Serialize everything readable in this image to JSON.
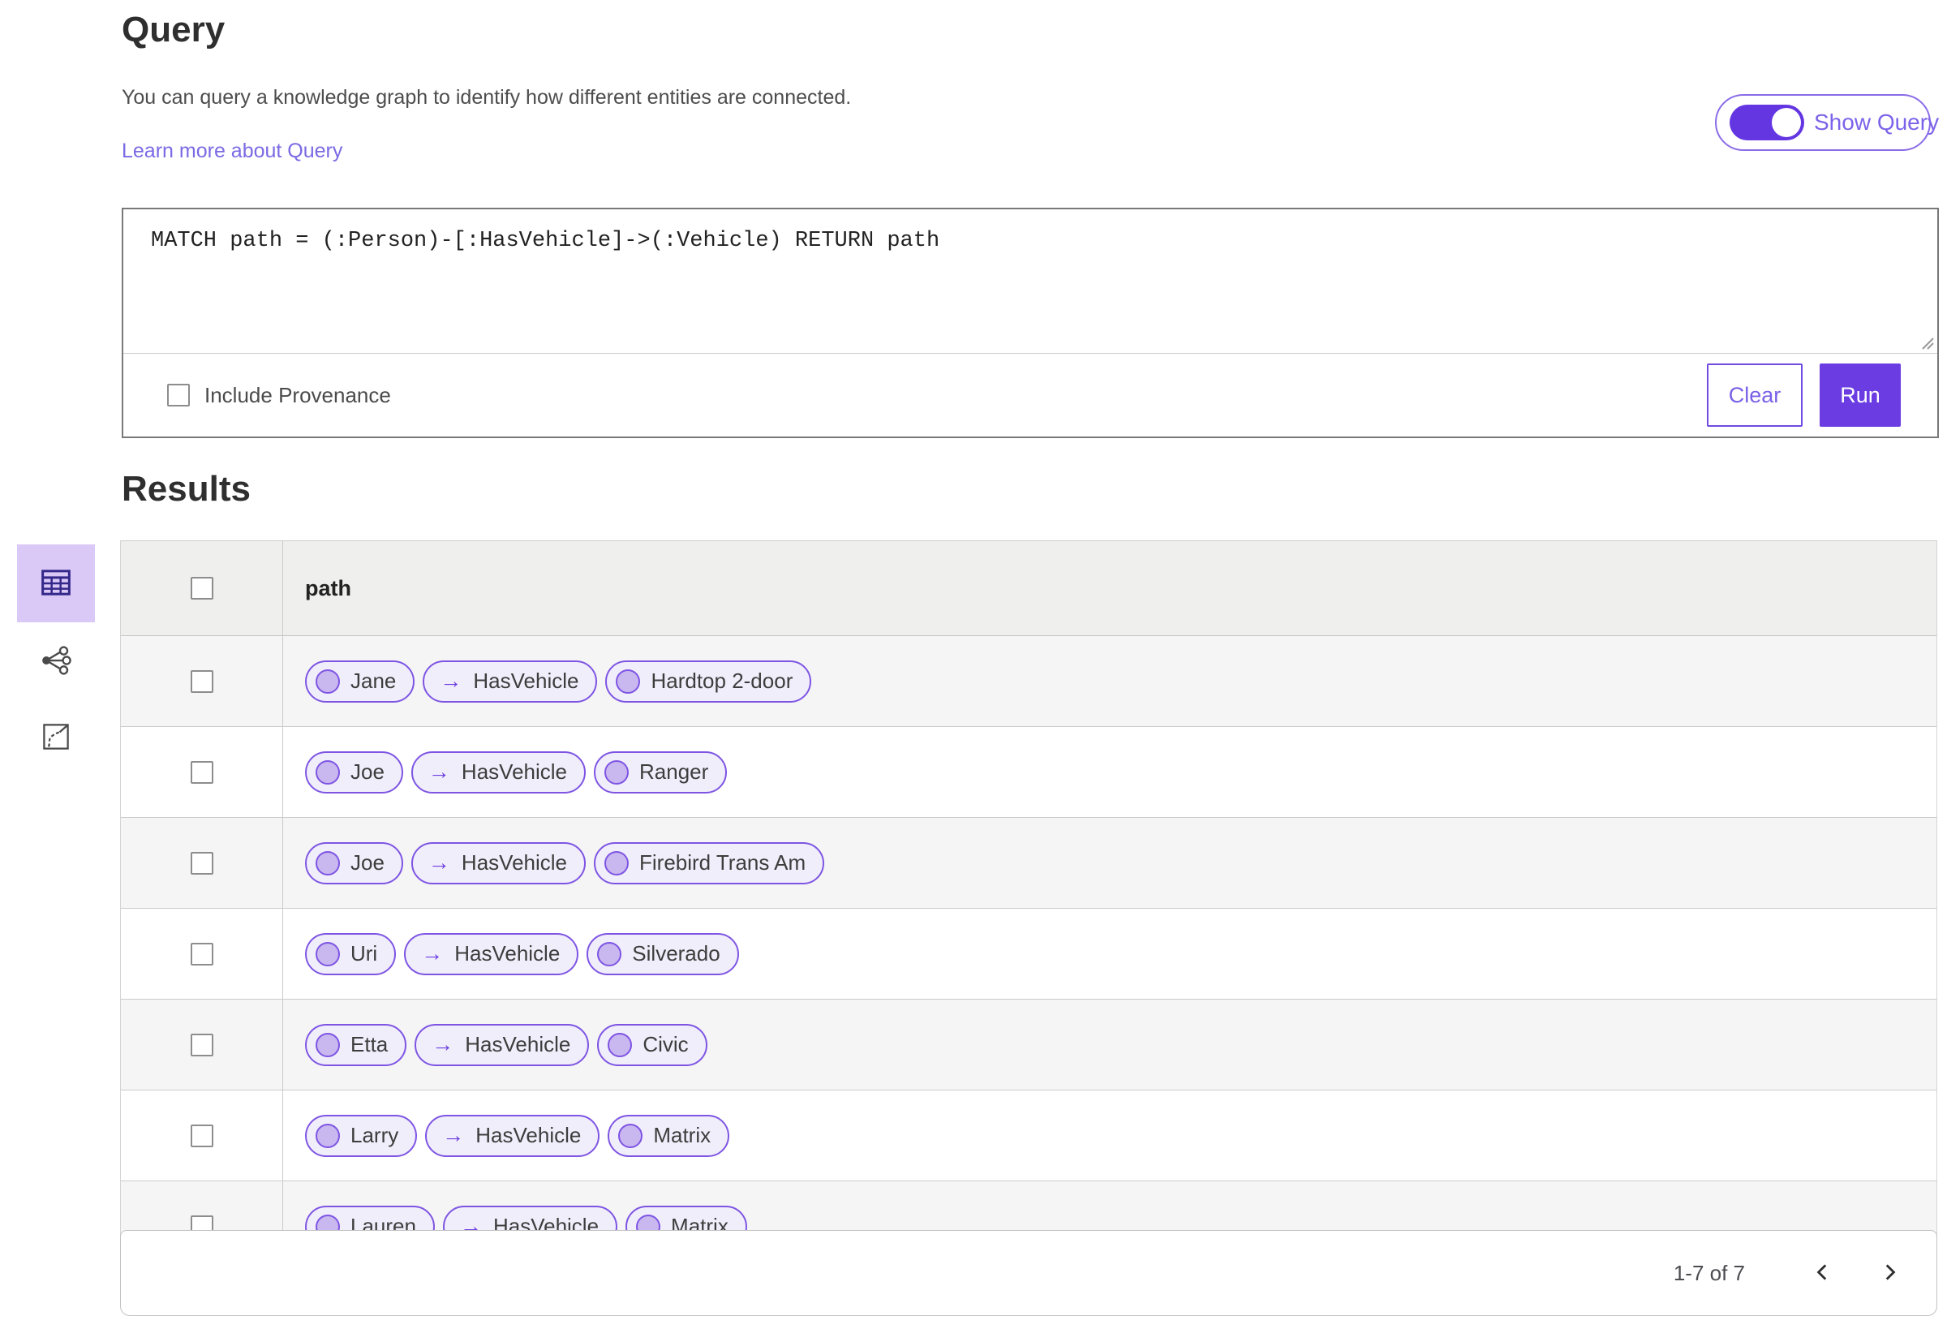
{
  "page": {
    "title": "Query",
    "description": "You can query a knowledge graph to identify how different entities are connected.",
    "learn_more_link": "Learn more about Query"
  },
  "show_query_toggle": {
    "label": "Show Query",
    "state": "on"
  },
  "query_panel": {
    "query_text": "MATCH path = (:Person)-[:HasVehicle]->(:Vehicle) RETURN path",
    "include_provenance_label": "Include Provenance",
    "include_provenance_checked": false,
    "clear_button": "Clear",
    "run_button": "Run"
  },
  "view_switcher": {
    "items": [
      {
        "id": "table-view",
        "icon": "table-icon",
        "selected": true
      },
      {
        "id": "graph-view",
        "icon": "graph-icon",
        "selected": false
      },
      {
        "id": "map-view",
        "icon": "map-icon",
        "selected": false
      }
    ]
  },
  "results": {
    "title": "Results",
    "column_header": "path",
    "relationship_arrow": "→",
    "rows": [
      {
        "source": "Jane",
        "relationship": "HasVehicle",
        "target": "Hardtop 2-door"
      },
      {
        "source": "Joe",
        "relationship": "HasVehicle",
        "target": "Ranger"
      },
      {
        "source": "Joe",
        "relationship": "HasVehicle",
        "target": "Firebird Trans Am"
      },
      {
        "source": "Uri",
        "relationship": "HasVehicle",
        "target": "Silverado"
      },
      {
        "source": "Etta",
        "relationship": "HasVehicle",
        "target": "Civic"
      },
      {
        "source": "Larry",
        "relationship": "HasVehicle",
        "target": "Matrix"
      },
      {
        "source": "Lauren",
        "relationship": "HasVehicle",
        "target": "Matrix"
      }
    ]
  },
  "pagination": {
    "range_label": "1-7 of 7"
  },
  "colors": {
    "accent": "#6a3ce2",
    "accent_light": "#dac8f7",
    "chip_border": "#7e55e3",
    "chip_fill": "#f1eefb",
    "chip_circle": "#c9b7f0",
    "link": "#7a6ae4",
    "row_stripe": "#f5f5f5"
  }
}
